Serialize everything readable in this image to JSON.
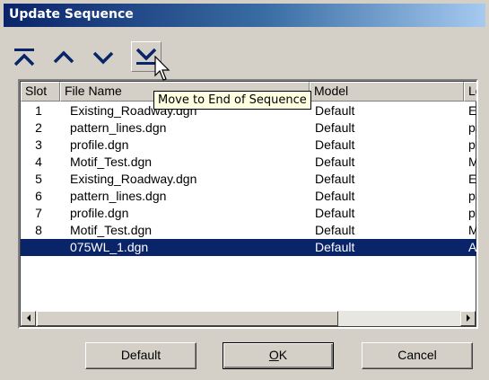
{
  "window": {
    "title": "Update Sequence"
  },
  "toolbar": {
    "buttons": [
      {
        "icon": "move-to-top-icon"
      },
      {
        "icon": "move-up-icon"
      },
      {
        "icon": "move-down-icon"
      },
      {
        "icon": "move-to-end-icon"
      }
    ],
    "tooltip": "Move to End of Sequence",
    "accent": "#0a246a"
  },
  "list": {
    "columns": [
      "Slot",
      "File Name",
      "Model",
      "Log"
    ],
    "rows": [
      {
        "slot": "1",
        "file": "Existing_Roadway.dgn",
        "model": "Default",
        "log": "Exi"
      },
      {
        "slot": "2",
        "file": "pattern_lines.dgn",
        "model": "Default",
        "log": "pat"
      },
      {
        "slot": "3",
        "file": "profile.dgn",
        "model": "Default",
        "log": "pro"
      },
      {
        "slot": "4",
        "file": "Motif_Test.dgn",
        "model": "Default",
        "log": "Mo"
      },
      {
        "slot": "5",
        "file": "Existing_Roadway.dgn",
        "model": "Default",
        "log": "Exi"
      },
      {
        "slot": "6",
        "file": "pattern_lines.dgn",
        "model": "Default",
        "log": "pat"
      },
      {
        "slot": "7",
        "file": "profile.dgn",
        "model": "Default",
        "log": "pro"
      },
      {
        "slot": "8",
        "file": "Motif_Test.dgn",
        "model": "Default",
        "log": "Mo"
      },
      {
        "slot": "",
        "file": "075WL_1.dgn",
        "model": "Default",
        "log": "Ac",
        "selected": true
      }
    ]
  },
  "buttons": {
    "default_label": "Default",
    "ok_label": "OK",
    "cancel_label": "Cancel"
  }
}
